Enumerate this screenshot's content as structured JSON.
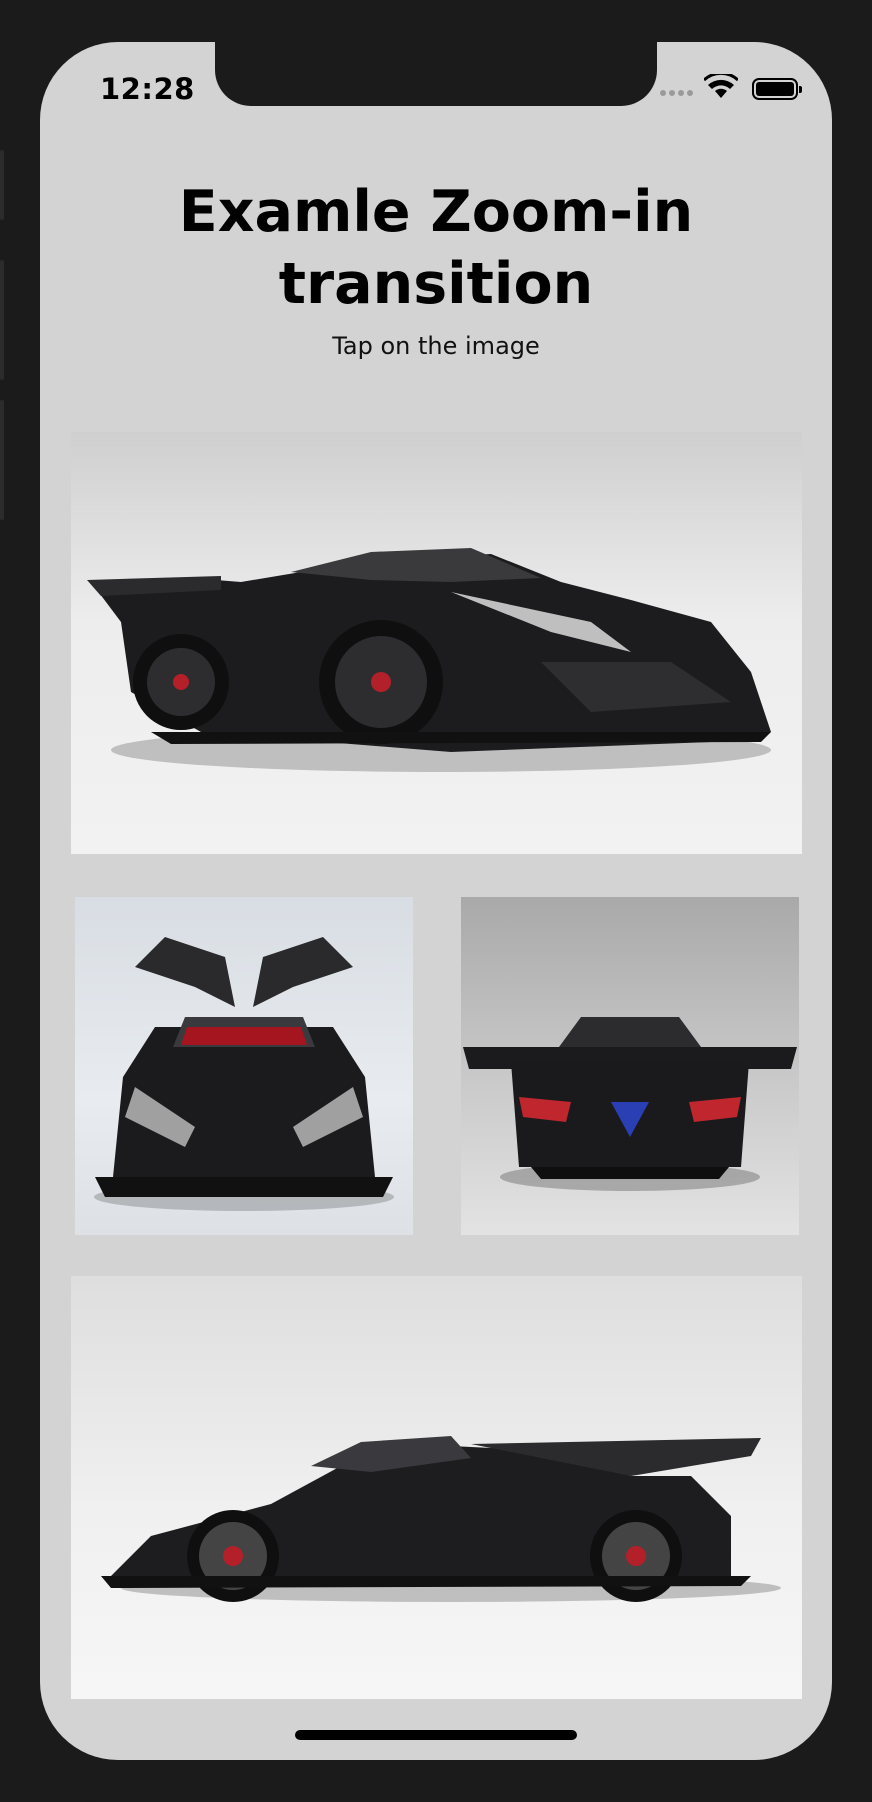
{
  "status_bar": {
    "time": "12:28"
  },
  "header": {
    "title": "Examle Zoom-in transition",
    "subtitle": "Tap on the image"
  },
  "gallery": {
    "images": [
      {
        "name": "car-front-three-quarter"
      },
      {
        "name": "car-front-doors-open"
      },
      {
        "name": "car-rear"
      },
      {
        "name": "car-side-profile"
      }
    ]
  },
  "colors": {
    "screen_background": "#d3d3d3",
    "frame": "#1b1b1b",
    "text": "#000000"
  }
}
